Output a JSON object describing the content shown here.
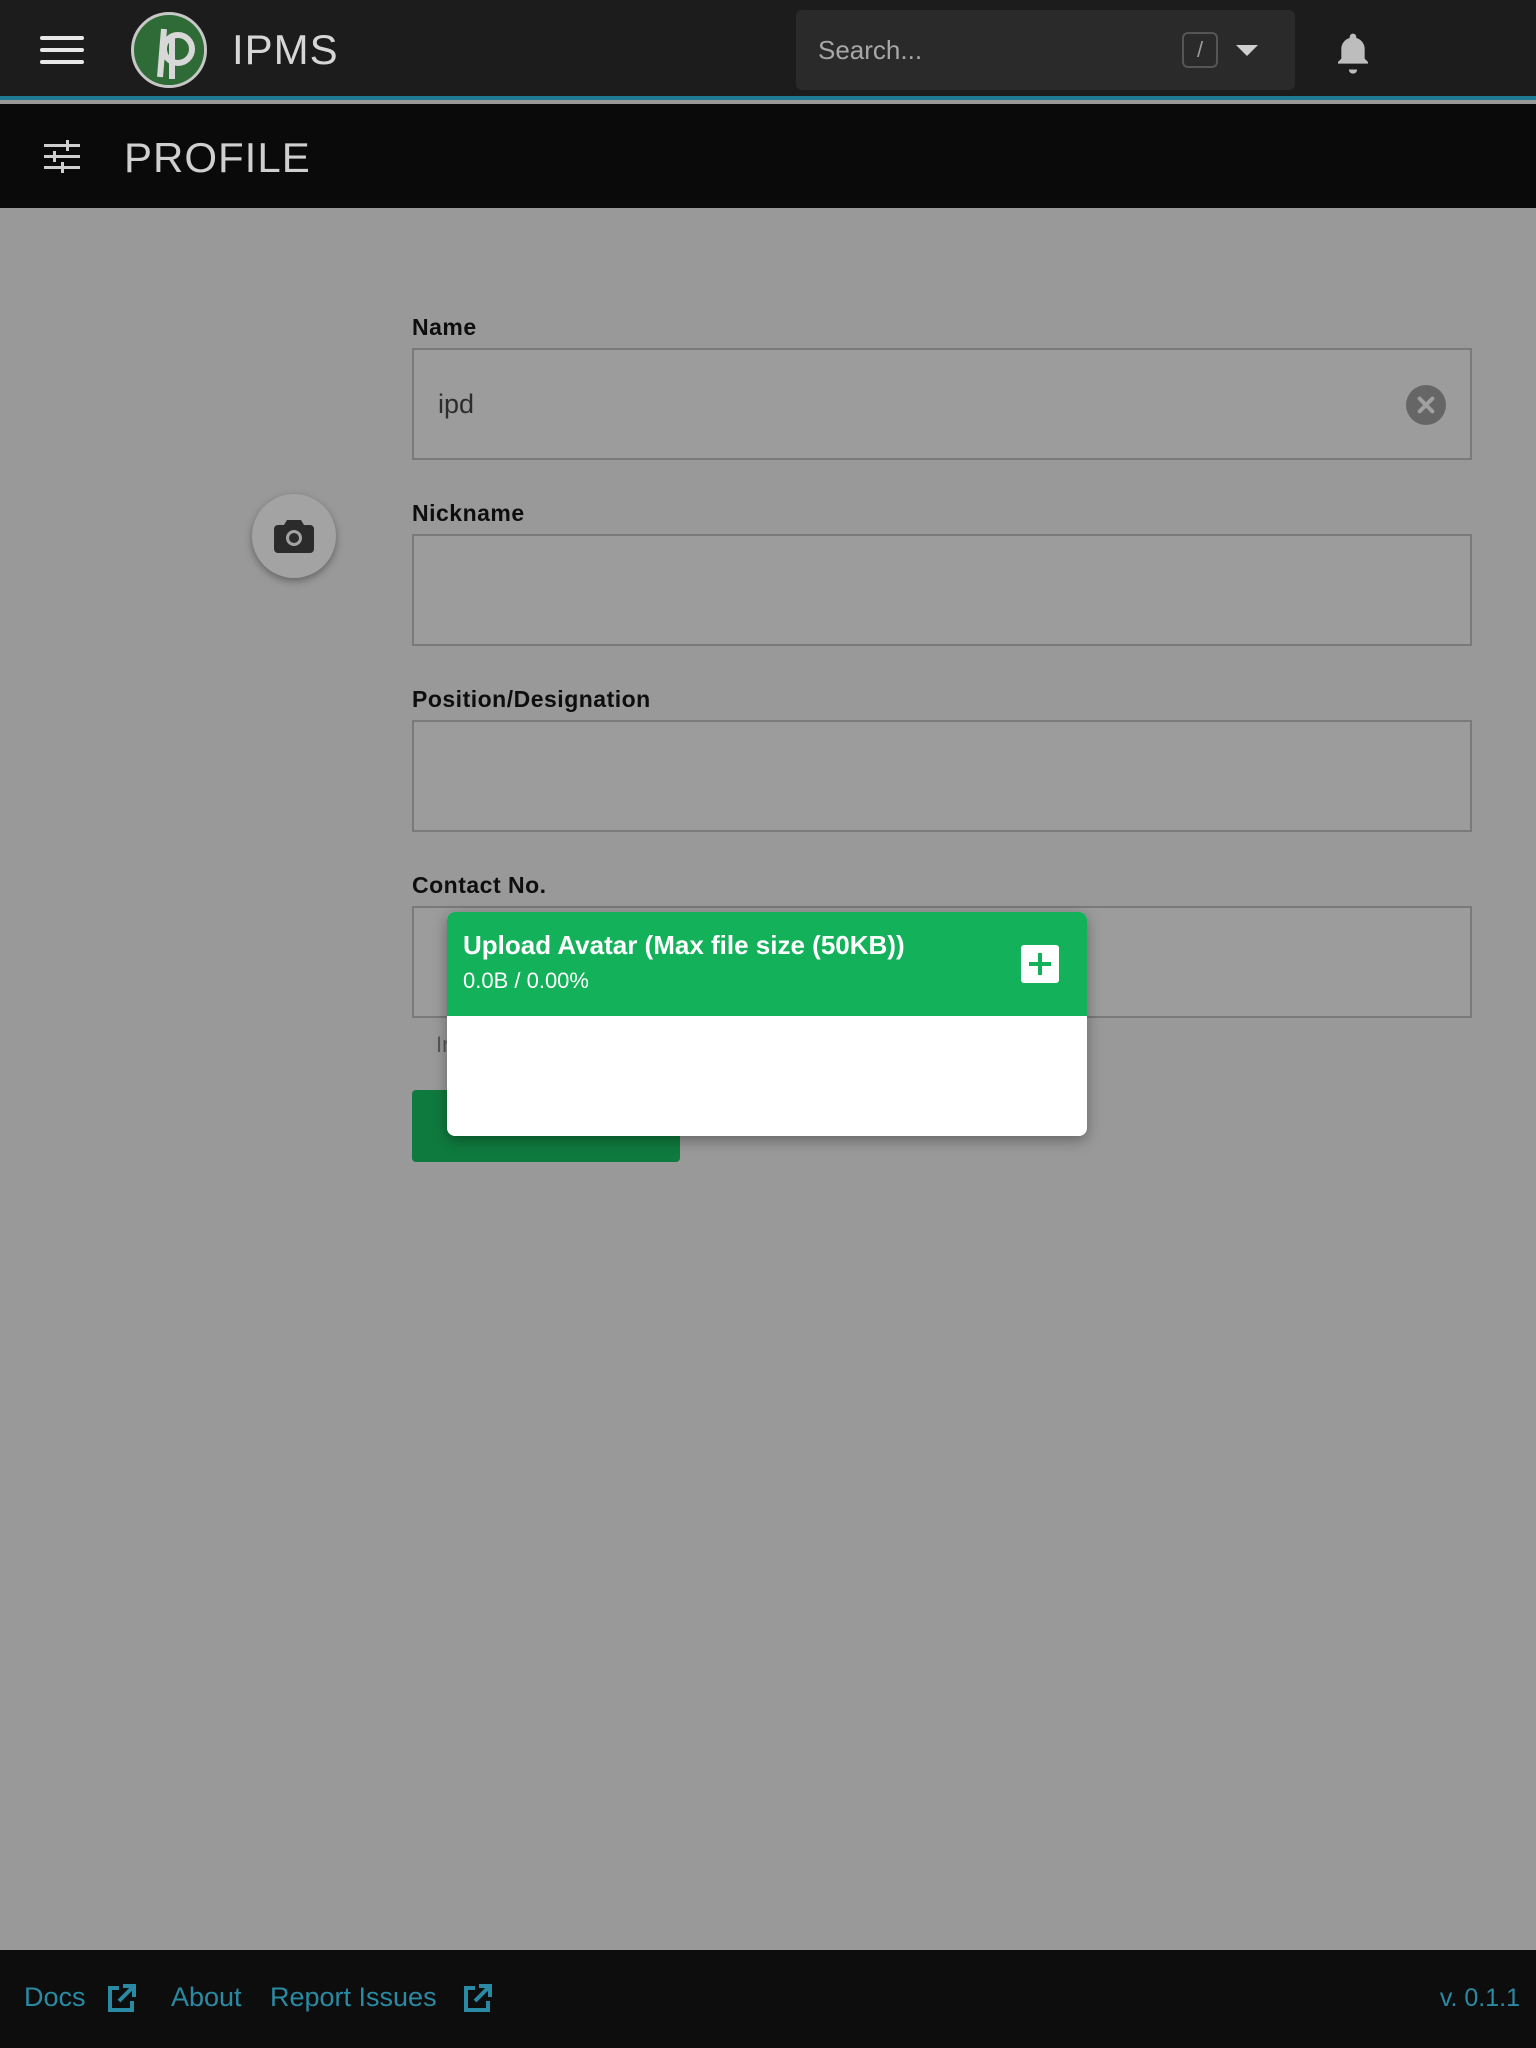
{
  "app": {
    "title": "IPMS"
  },
  "search": {
    "placeholder": "Search...",
    "shortcut": "/"
  },
  "page": {
    "title": "PROFILE"
  },
  "form": {
    "name_label": "Name",
    "name_value": "ipd",
    "nickname_label": "Nickname",
    "nickname_value": "",
    "position_label": "Position/Designation",
    "position_value": "",
    "contact_label": "Contact No.",
    "contact_value": "",
    "hint_partial": "In"
  },
  "upload": {
    "title": "Upload Avatar (Max file size (50KB))",
    "progress": "0.0B / 0.00%"
  },
  "footer": {
    "docs": "Docs",
    "about": "About",
    "report": "Report Issues",
    "version": "v. 0.1.1"
  },
  "colors": {
    "accent": "#1f7a94",
    "primary_green": "#12b15a",
    "link": "#2a8aa3"
  },
  "icons": [
    "menu-icon",
    "logo",
    "chevron-down-icon",
    "bell-icon",
    "tune-icon",
    "camera-icon",
    "close-icon",
    "plus-icon",
    "open-in-new-icon"
  ]
}
